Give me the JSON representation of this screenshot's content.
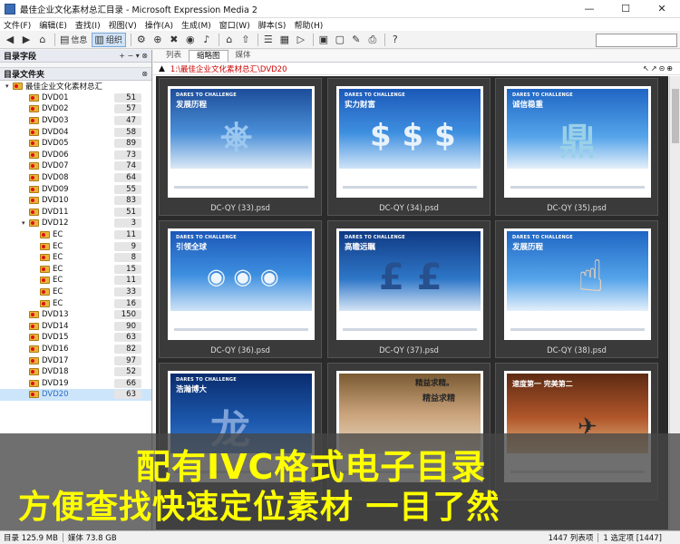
{
  "window": {
    "title": "最佳企业文化素材总汇目录 - Microsoft Expression Media 2",
    "minimize": "—",
    "maximize": "☐",
    "close": "✕"
  },
  "menu": [
    "文件(F)",
    "编辑(E)",
    "查找(I)",
    "视图(V)",
    "操作(A)",
    "生成(M)",
    "窗口(W)",
    "脚本(S)",
    "帮助(H)"
  ],
  "toolbar": {
    "info_label": "信息",
    "organize_label": "组织"
  },
  "left_panel": {
    "catalog_fields": "目录字段",
    "catalog_folders": "目录文件夹",
    "panel_controls": "+ − ▾ ⊗"
  },
  "tree": {
    "root": "最佳企业文化素材总汇",
    "items": [
      {
        "name": "DVD01",
        "count": "51"
      },
      {
        "name": "DVD02",
        "count": "57"
      },
      {
        "name": "DVD03",
        "count": "47"
      },
      {
        "name": "DVD04",
        "count": "58"
      },
      {
        "name": "DVD05",
        "count": "89"
      },
      {
        "name": "DVD06",
        "count": "73"
      },
      {
        "name": "DVD07",
        "count": "74"
      },
      {
        "name": "DVD08",
        "count": "64"
      },
      {
        "name": "DVD09",
        "count": "55"
      },
      {
        "name": "DVD10",
        "count": "83"
      },
      {
        "name": "DVD11",
        "count": "51"
      },
      {
        "name": "DVD12",
        "count": "3"
      }
    ],
    "sub_items": [
      {
        "name": "EC",
        "count": "11"
      },
      {
        "name": "EC",
        "count": "9"
      },
      {
        "name": "EC",
        "count": "8"
      },
      {
        "name": "EC",
        "count": "15"
      },
      {
        "name": "EC",
        "count": "11"
      },
      {
        "name": "EC",
        "count": "33"
      },
      {
        "name": "EC",
        "count": "16"
      }
    ],
    "items_after": [
      {
        "name": "DVD13",
        "count": "150"
      },
      {
        "name": "DVD14",
        "count": "90"
      },
      {
        "name": "DVD15",
        "count": "63"
      },
      {
        "name": "DVD16",
        "count": "82"
      },
      {
        "name": "DVD17",
        "count": "97"
      },
      {
        "name": "DVD18",
        "count": "52"
      },
      {
        "name": "DVD19",
        "count": "66"
      },
      {
        "name": "DVD20",
        "count": "63"
      }
    ]
  },
  "tabs": [
    "列表",
    "缩略图",
    "媒体"
  ],
  "path": "1:\\最佳企业文化素材总汇\\DVD20",
  "thumbnails": [
    {
      "header": "DARES TO CHALLENGE",
      "title": "发展历程",
      "caption": "DC-QY (33).psd",
      "figure": "⎈"
    },
    {
      "header": "DARES TO CHALLENGE",
      "title": "实力财富",
      "caption": "DC-QY (34).psd",
      "figure": "$ $ $"
    },
    {
      "header": "DARES TO CHALLENGE",
      "title": "诚信稳重",
      "caption": "DC-QY (35).psd",
      "figure": "鼎"
    },
    {
      "header": "DARES TO CHALLENGE",
      "title": "引领全球",
      "caption": "DC-QY (36).psd",
      "figure": "◉ ◉ ◉"
    },
    {
      "header": "DARES TO CHALLENGE",
      "title": "高瞻远瞩",
      "caption": "DC-QY (37).psd",
      "figure": "£ £"
    },
    {
      "header": "DARES TO CHALLENGE",
      "title": "发展历程",
      "caption": "DC-QY (38).psd",
      "figure": "☝"
    },
    {
      "header": "DARES TO CHALLENGE",
      "title": "浩瀚博大",
      "caption": "",
      "figure": "龙"
    },
    {
      "header": "",
      "title": "精益求精。",
      "caption": "",
      "figure": "精益求精"
    },
    {
      "header": "",
      "title": "速度第一 完美第二",
      "caption": "",
      "figure": "✈"
    }
  ],
  "banner": {
    "line1": "配有IVC格式电子目录",
    "line2": "方便查找快速定位素材 一目了然"
  },
  "status": {
    "catalog": "目录 125.9 MB",
    "media": "媒体 73.8 GB",
    "items_shown": "1447 列表项",
    "selection": "1 选定项 [1447]"
  }
}
